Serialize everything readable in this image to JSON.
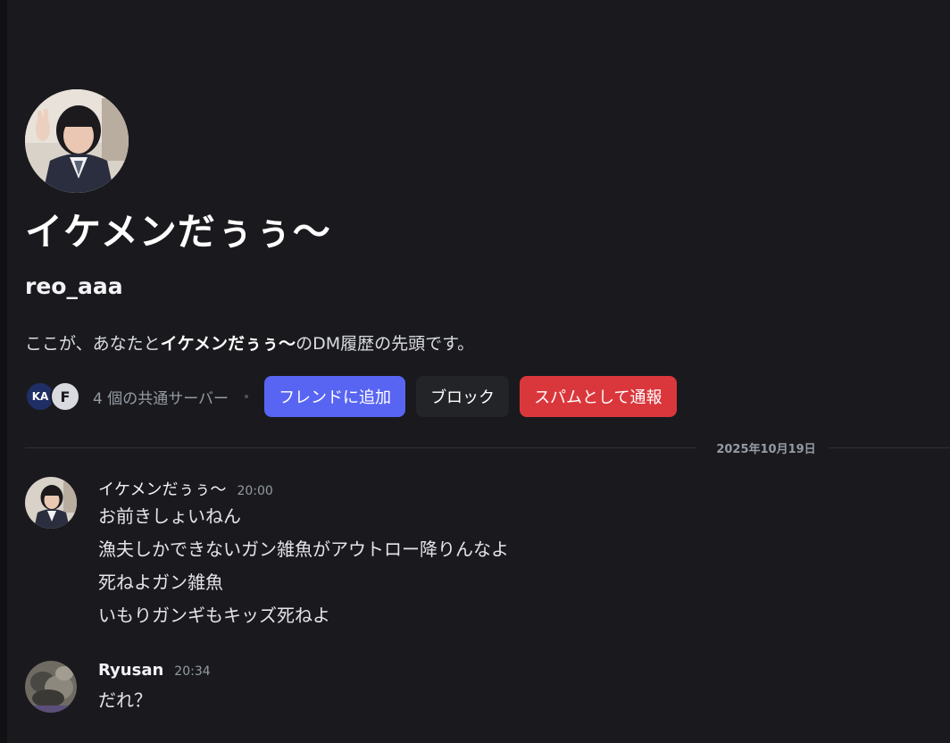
{
  "profile": {
    "display_name": "イケメンだぅぅ〜",
    "username": "reo_aaa",
    "intro_prefix": "ここが、あなたと",
    "intro_name": "イケメンだぅぅ〜",
    "intro_suffix": "のDM履歴の先頭です。"
  },
  "mutual": {
    "server_icon_1": "KA",
    "server_icon_2": "F",
    "count_text": "4 個の共通サーバー"
  },
  "buttons": {
    "add_friend": "フレンドに追加",
    "block": "ブロック",
    "report_spam": "スパムとして通報"
  },
  "divider": {
    "date": "2025年10月19日"
  },
  "messages": [
    {
      "author": "イケメンだぅぅ〜",
      "time": "20:00",
      "lines": [
        "お前きしょいねん",
        "漁夫しかできないガン雑魚がアウトロー降りんなよ",
        "死ねよガン雑魚",
        "いもりガンギもキッズ死ねよ"
      ]
    },
    {
      "author": "Ryusan",
      "time": "20:34",
      "lines": [
        "だれ？"
      ]
    }
  ],
  "colors": {
    "background": "#1a1a1e",
    "primary_button": "#5865f2",
    "danger_button": "#da373c",
    "secondary_button": "#232428"
  }
}
